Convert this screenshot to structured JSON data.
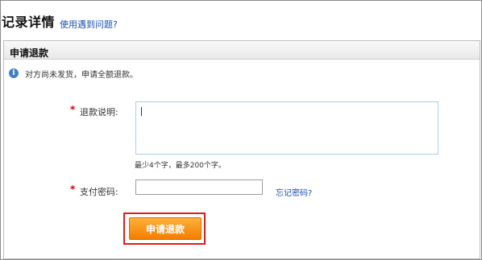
{
  "header": {
    "title": "记录详情",
    "help_link": "使用遇到问题?"
  },
  "panel": {
    "title": "申请退款",
    "info_icon": "info-icon",
    "info_text": "对方尚未发货，申请全额退款。"
  },
  "form": {
    "required_mark": "*",
    "refund_reason_label": "退款说明:",
    "refund_reason_value": "",
    "refund_reason_hint": "最少4个字，最多200个字。",
    "password_label": "支付密码:",
    "password_value": "",
    "forgot_password_link": "忘记密码?",
    "submit_label": "申请退款"
  },
  "colors": {
    "link": "#1a4fb3",
    "required": "#d40000",
    "button": "#f27e00",
    "highlight": "#e01b1b"
  }
}
